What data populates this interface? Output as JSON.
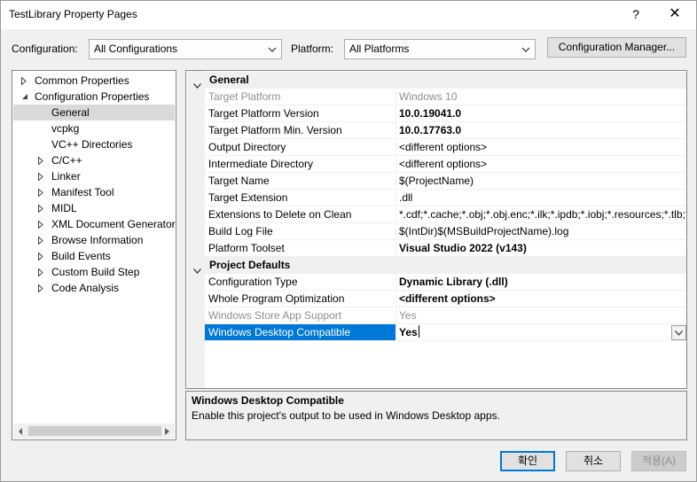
{
  "window": {
    "title": "TestLibrary Property Pages",
    "help_glyph": "?",
    "close_glyph": "✕"
  },
  "config": {
    "configuration_label": "Configuration:",
    "configuration_value": "All Configurations",
    "platform_label": "Platform:",
    "platform_value": "All Platforms",
    "manager_button": "Configuration Manager..."
  },
  "tree": {
    "items": [
      {
        "label": "Common Properties",
        "expander": "collapsed"
      },
      {
        "label": "Configuration Properties",
        "expander": "expanded"
      },
      {
        "label": "General",
        "expander": "none",
        "selected": true
      },
      {
        "label": "vcpkg",
        "expander": "none"
      },
      {
        "label": "VC++ Directories",
        "expander": "none"
      },
      {
        "label": "C/C++",
        "expander": "collapsed"
      },
      {
        "label": "Linker",
        "expander": "collapsed"
      },
      {
        "label": "Manifest Tool",
        "expander": "collapsed"
      },
      {
        "label": "MIDL",
        "expander": "collapsed"
      },
      {
        "label": "XML Document Generator",
        "expander": "collapsed"
      },
      {
        "label": "Browse Information",
        "expander": "collapsed"
      },
      {
        "label": "Build Events",
        "expander": "collapsed"
      },
      {
        "label": "Custom Build Step",
        "expander": "collapsed"
      },
      {
        "label": "Code Analysis",
        "expander": "collapsed"
      }
    ]
  },
  "grid": {
    "categories": [
      {
        "label": "General",
        "rows": [
          {
            "name": "Target Platform",
            "value": "Windows 10",
            "dim": true
          },
          {
            "name": "Target Platform Version",
            "value": "10.0.19041.0",
            "bold": true
          },
          {
            "name": "Target Platform Min. Version",
            "value": "10.0.17763.0",
            "bold": true
          },
          {
            "name": "Output Directory",
            "value": "<different options>"
          },
          {
            "name": "Intermediate Directory",
            "value": "<different options>"
          },
          {
            "name": "Target Name",
            "value": "$(ProjectName)"
          },
          {
            "name": "Target Extension",
            "value": ".dll"
          },
          {
            "name": "Extensions to Delete on Clean",
            "value": "*.cdf;*.cache;*.obj;*.obj.enc;*.ilk;*.ipdb;*.iobj;*.resources;*.tlb;*.tli;"
          },
          {
            "name": "Build Log File",
            "value": "$(IntDir)$(MSBuildProjectName).log"
          },
          {
            "name": "Platform Toolset",
            "value": "Visual Studio 2022 (v143)",
            "bold": true
          }
        ]
      },
      {
        "label": "Project Defaults",
        "rows": [
          {
            "name": "Configuration Type",
            "value": "Dynamic Library (.dll)",
            "bold": true
          },
          {
            "name": "Whole Program Optimization",
            "value": "<different options>",
            "bold": true
          },
          {
            "name": "Windows Store App Support",
            "value": "Yes",
            "dim": true
          },
          {
            "name": "Windows Desktop Compatible",
            "value": "Yes",
            "bold": true,
            "selected": true
          }
        ]
      }
    ]
  },
  "description": {
    "title": "Windows Desktop Compatible",
    "text": "Enable this project's output to be used in Windows Desktop apps."
  },
  "buttons": {
    "ok": "확인",
    "cancel": "취소",
    "apply": "적용(A)"
  }
}
